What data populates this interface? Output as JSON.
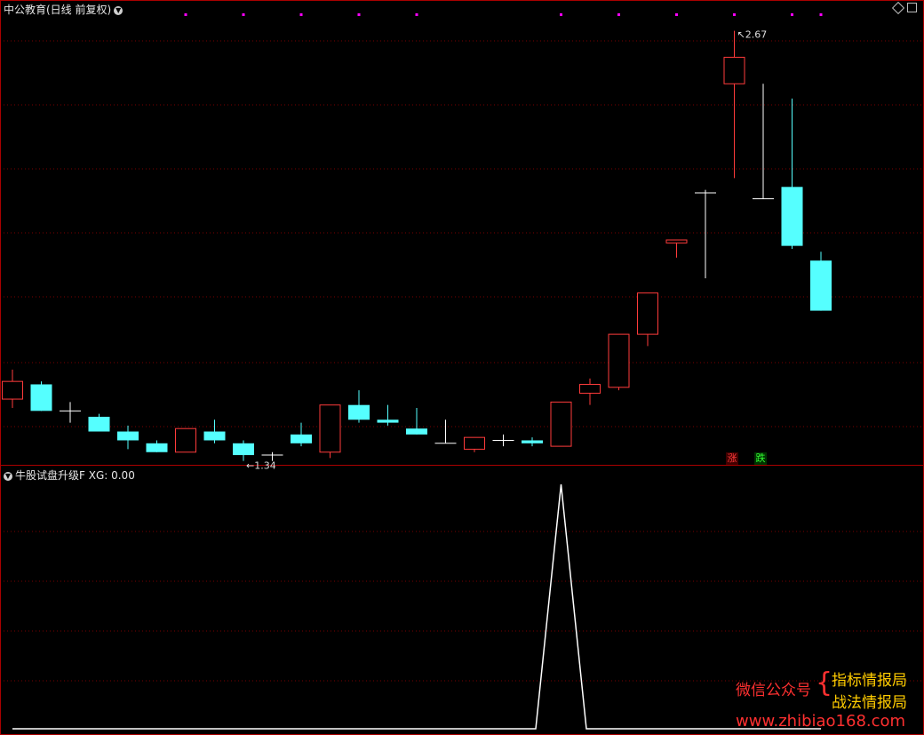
{
  "header": {
    "main_title": "中公教育(日线 前复权)",
    "indicator_title": "牛股试盘升级F",
    "indicator_value": "XG: 0.00"
  },
  "badges": {
    "rise": "涨",
    "fall": "跌"
  },
  "watermark": {
    "left": "微信公众号",
    "right_top": "指标情报局",
    "right_bottom": "战法情报局",
    "url": "www.zhibiao168.com"
  },
  "colors": {
    "up": "#ff3b3b",
    "down": "#55ffff",
    "flat": "#ffffff",
    "grid": "#7a0000",
    "frame": "#aa0000",
    "marker": "#ff00ff",
    "indicator": "#ffffff"
  },
  "chart_data": {
    "type": "candlestick",
    "price_range": [
      1.2,
      2.72
    ],
    "min_label": "1.34",
    "max_label": "2.67",
    "candles": [
      {
        "o": 1.42,
        "h": 1.52,
        "l": 1.39,
        "c": 1.48
      },
      {
        "o": 1.47,
        "h": 1.48,
        "l": 1.38,
        "c": 1.38
      },
      {
        "o": 1.38,
        "h": 1.41,
        "l": 1.34,
        "c": 1.38
      },
      {
        "o": 1.36,
        "h": 1.37,
        "l": 1.31,
        "c": 1.31
      },
      {
        "o": 1.31,
        "h": 1.33,
        "l": 1.25,
        "c": 1.28
      },
      {
        "o": 1.27,
        "h": 1.28,
        "l": 1.24,
        "c": 1.24
      },
      {
        "o": 1.24,
        "h": 1.32,
        "l": 1.24,
        "c": 1.32
      },
      {
        "o": 1.31,
        "h": 1.35,
        "l": 1.27,
        "c": 1.28
      },
      {
        "o": 1.27,
        "h": 1.28,
        "l": 1.21,
        "c": 1.23
      },
      {
        "o": 1.23,
        "h": 1.24,
        "l": 1.21,
        "c": 1.23
      },
      {
        "o": 1.3,
        "h": 1.34,
        "l": 1.26,
        "c": 1.27
      },
      {
        "o": 1.24,
        "h": 1.4,
        "l": 1.22,
        "c": 1.4
      },
      {
        "o": 1.4,
        "h": 1.45,
        "l": 1.34,
        "c": 1.35
      },
      {
        "o": 1.35,
        "h": 1.4,
        "l": 1.33,
        "c": 1.34
      },
      {
        "o": 1.32,
        "h": 1.39,
        "l": 1.3,
        "c": 1.3
      },
      {
        "o": 1.27,
        "h": 1.35,
        "l": 1.27,
        "c": 1.27
      },
      {
        "o": 1.25,
        "h": 1.29,
        "l": 1.24,
        "c": 1.29
      },
      {
        "o": 1.28,
        "h": 1.3,
        "l": 1.26,
        "c": 1.28
      },
      {
        "o": 1.28,
        "h": 1.29,
        "l": 1.26,
        "c": 1.27
      },
      {
        "o": 1.26,
        "h": 1.41,
        "l": 1.26,
        "c": 1.41
      },
      {
        "o": 1.44,
        "h": 1.49,
        "l": 1.4,
        "c": 1.47
      },
      {
        "o": 1.46,
        "h": 1.64,
        "l": 1.45,
        "c": 1.64
      },
      {
        "o": 1.64,
        "h": 1.78,
        "l": 1.6,
        "c": 1.78
      },
      {
        "o": 1.95,
        "h": 1.96,
        "l": 1.9,
        "c": 1.96
      },
      {
        "o": 2.12,
        "h": 2.13,
        "l": 1.83,
        "c": 2.12
      },
      {
        "o": 2.49,
        "h": 2.67,
        "l": 2.17,
        "c": 2.58
      },
      {
        "o": 2.1,
        "h": 2.49,
        "l": 2.1,
        "c": 2.1
      },
      {
        "o": 2.14,
        "h": 2.44,
        "l": 1.93,
        "c": 1.94
      },
      {
        "o": 1.89,
        "h": 1.92,
        "l": 1.72,
        "c": 1.72
      }
    ],
    "markers_at": [
      6,
      8,
      10,
      12,
      14,
      19,
      21,
      23,
      25,
      27,
      28
    ],
    "indicator": {
      "name": "XG",
      "range": [
        0,
        1
      ],
      "values": [
        0,
        0,
        0,
        0,
        0,
        0,
        0,
        0,
        0,
        0,
        0,
        0,
        0,
        0,
        0,
        0,
        0,
        0,
        0,
        1,
        0,
        0,
        0,
        0,
        0,
        0,
        0,
        0,
        0
      ]
    }
  }
}
